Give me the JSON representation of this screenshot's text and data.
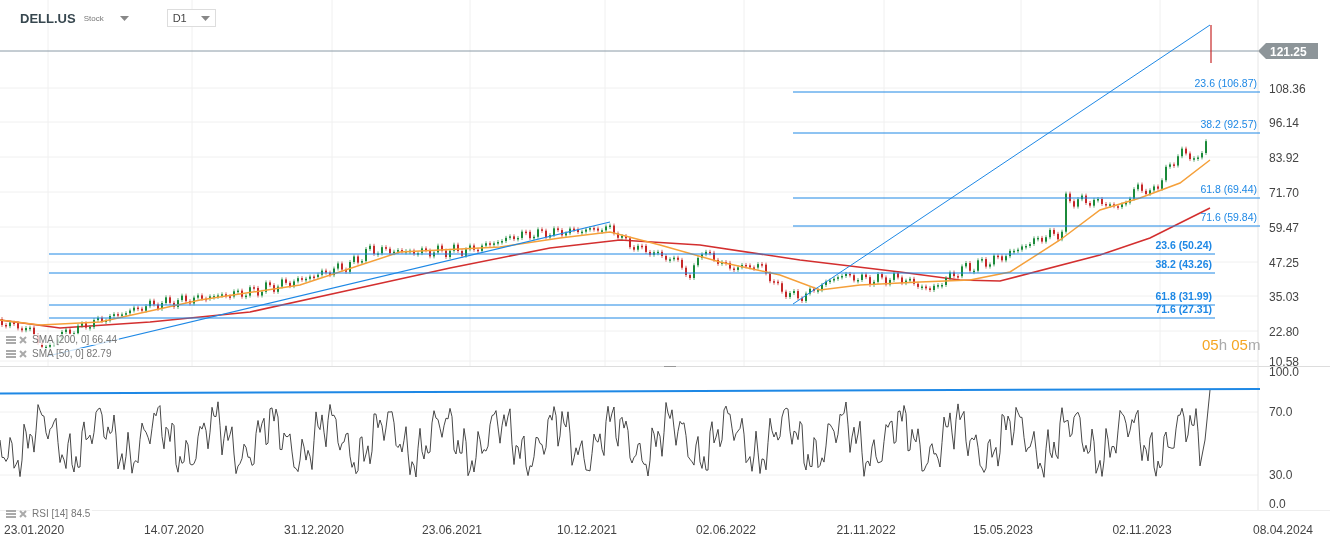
{
  "header": {
    "symbol": "DELL.US",
    "instrument_type": "Stock",
    "timeframe": "D1"
  },
  "price_axis": {
    "current_price": "121.25",
    "labels": [
      "108.36",
      "96.14",
      "83.92",
      "71.70",
      "59.47",
      "47.25",
      "35.03",
      "22.80",
      "10.58"
    ]
  },
  "fibonacci": [
    {
      "label": "23.6 (106.87)"
    },
    {
      "label": "38.2 (92.57)"
    },
    {
      "label": "61.8 (69.44)"
    },
    {
      "label": "71.6 (59.84)"
    },
    {
      "label": "23.6 (50.24)"
    },
    {
      "label": "38.2 (43.26)"
    },
    {
      "label": "61.8 (31.99)"
    },
    {
      "label": "71.6 (27.31)"
    }
  ],
  "indicators": [
    {
      "label": "SMA [200, 0] 66.44"
    },
    {
      "label": "SMA [50, 0] 82.79"
    }
  ],
  "countdown": {
    "hours": "05",
    "hours_unit": "h",
    "minutes": "05",
    "minutes_unit": "m"
  },
  "rsi": {
    "label": "RSI [14] 84.5",
    "axis": [
      "100.0",
      "70.0",
      "30.0",
      "0.0"
    ]
  },
  "date_axis": [
    "23.01.2020",
    "14.07.2020",
    "31.12.2020",
    "23.06.2021",
    "10.12.2021",
    "02.06.2022",
    "21.11.2022",
    "15.05.2023",
    "02.11.2023",
    "08.04.2024"
  ]
}
